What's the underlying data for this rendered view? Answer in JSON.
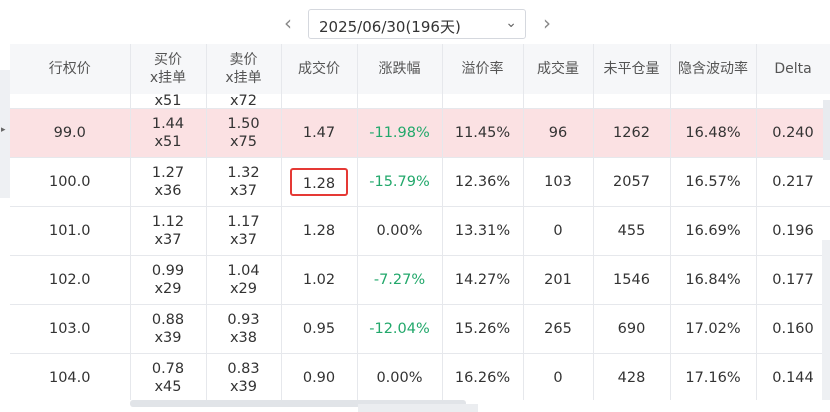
{
  "date_nav": {
    "prev_icon": "‹",
    "next_icon": "›",
    "selected_date": "2025/06/30(196天)",
    "dropdown_icon": "⌄"
  },
  "columns": [
    "行权价",
    "买价\nx挂单",
    "卖价\nx挂单",
    "成交价",
    "涨跌幅",
    "溢价率",
    "成交量",
    "未平仓量",
    "隐含波动率",
    "Delta"
  ],
  "partial_row": {
    "bid_qty": "x51",
    "ask_qty": "x72"
  },
  "rows": [
    {
      "strike": "99.0",
      "bid": "1.44",
      "bid_qty": "x51",
      "ask": "1.50",
      "ask_qty": "x75",
      "last": "1.47",
      "change": "-11.98%",
      "premium": "11.45%",
      "volume": "96",
      "oi": "1262",
      "iv": "16.48%",
      "delta": "0.240"
    },
    {
      "strike": "100.0",
      "bid": "1.27",
      "bid_qty": "x36",
      "ask": "1.32",
      "ask_qty": "x37",
      "last": "1.28",
      "change": "-15.79%",
      "premium": "12.36%",
      "volume": "103",
      "oi": "2057",
      "iv": "16.57%",
      "delta": "0.217"
    },
    {
      "strike": "101.0",
      "bid": "1.12",
      "bid_qty": "x37",
      "ask": "1.17",
      "ask_qty": "x37",
      "last": "1.28",
      "change": "0.00%",
      "premium": "13.31%",
      "volume": "0",
      "oi": "455",
      "iv": "16.69%",
      "delta": "0.196"
    },
    {
      "strike": "102.0",
      "bid": "0.99",
      "bid_qty": "x29",
      "ask": "1.04",
      "ask_qty": "x29",
      "last": "1.02",
      "change": "-7.27%",
      "premium": "14.27%",
      "volume": "201",
      "oi": "1546",
      "iv": "16.84%",
      "delta": "0.177"
    },
    {
      "strike": "103.0",
      "bid": "0.88",
      "bid_qty": "x39",
      "ask": "0.93",
      "ask_qty": "x38",
      "last": "0.95",
      "change": "-12.04%",
      "premium": "15.26%",
      "volume": "265",
      "oi": "690",
      "iv": "17.02%",
      "delta": "0.160"
    },
    {
      "strike": "104.0",
      "bid": "0.78",
      "bid_qty": "x45",
      "ask": "0.83",
      "ask_qty": "x39",
      "last": "0.90",
      "change": "0.00%",
      "premium": "16.26%",
      "volume": "0",
      "oi": "428",
      "iv": "17.16%",
      "delta": "0.144"
    }
  ],
  "colors": {
    "highlight_row": "#fbe1e3",
    "negative": "#22a86b",
    "selected_box": "#e53935"
  },
  "left_tab_icon": "▸"
}
